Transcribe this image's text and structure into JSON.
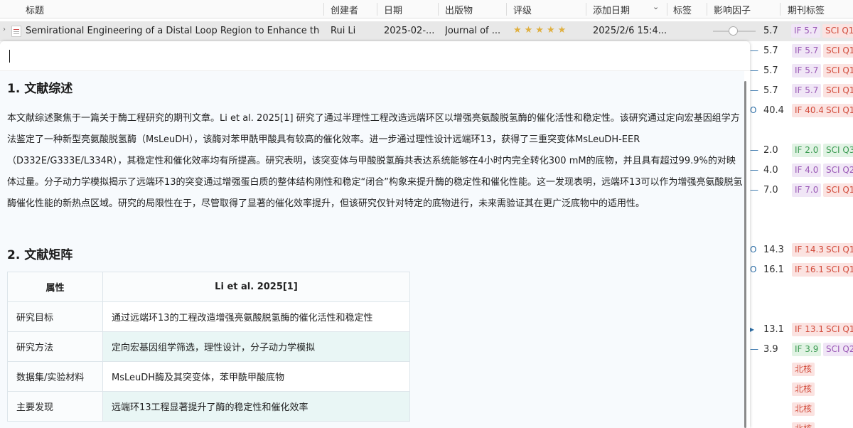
{
  "columns": [
    "标题",
    "创建者",
    "日期",
    "出版物",
    "评级",
    "添加日期",
    "标签",
    "影响因子",
    "期刊标签"
  ],
  "selected_row": {
    "title": "Semirational Engineering of a Distal Loop Region to Enhance the C",
    "creator": "Rui Li",
    "date": "2025-02-...",
    "publication": "Journal of ...",
    "rating_count": 5,
    "rating_glyph": "★★★★★",
    "added": "2025/2/6 15:4...",
    "impact_factor": "5.7",
    "if_tag": "IF 5.7",
    "sci_tag": "SCI Q1"
  },
  "right_rows": [
    {
      "mark": "—",
      "if": "5.7",
      "if_tag": "IF 5.7",
      "sci": "SCI Q1",
      "if_color": "purple",
      "sci_color": "red"
    },
    {
      "mark": "—",
      "if": "5.7",
      "if_tag": "IF 5.7",
      "sci": "SCI Q1",
      "if_color": "purple",
      "sci_color": "red"
    },
    {
      "mark": "—",
      "if": "5.7",
      "if_tag": "IF 5.7",
      "sci": "SCI Q1",
      "if_color": "purple",
      "sci_color": "red"
    },
    {
      "mark": "O",
      "if": "40.4",
      "if_tag": "IF 40.4",
      "sci": "SCI Q1",
      "if_color": "red",
      "sci_color": "red"
    },
    {
      "mark": "—",
      "if": "2.0",
      "if_tag": "IF 2.0",
      "sci": "SCI Q3",
      "if_color": "green",
      "sci_color": "green"
    },
    {
      "mark": "—",
      "if": "4.0",
      "if_tag": "IF 4.0",
      "sci": "SCI Q2",
      "if_color": "purple",
      "sci_color": "purple"
    },
    {
      "mark": "—",
      "if": "7.0",
      "if_tag": "IF 7.0",
      "sci": "SCI Q1",
      "if_color": "purple",
      "sci_color": "red"
    },
    {
      "mark": "O",
      "if": "14.3",
      "if_tag": "IF 14.3",
      "sci": "SCI Q1",
      "if_color": "red",
      "sci_color": "red"
    },
    {
      "mark": "O",
      "if": "16.1",
      "if_tag": "IF 16.1",
      "sci": "SCI Q1",
      "if_color": "red",
      "sci_color": "red"
    },
    {
      "mark": "▸",
      "if": "13.1",
      "if_tag": "IF 13.1",
      "sci": "SCI Q1",
      "if_color": "red",
      "sci_color": "red"
    },
    {
      "mark": "—",
      "if": "3.9",
      "if_tag": "IF 3.9",
      "sci": "SCI Q2",
      "if_color": "green",
      "sci_color": "purple"
    }
  ],
  "beihe_label": "北核",
  "note": {
    "h1": "1. 文献综述",
    "para": "本文献综述聚焦于一篇关于酶工程研究的期刊文章。Li et al. 2025[1] 研究了通过半理性工程改造远端环区以增强亮氨酸脱氢酶的催化活性和稳定性。该研究通过定向宏基因组学方法鉴定了一种新型亮氨酸脱氢酶（MsLeuDH），该酶对苯甲酰甲酸具有较高的催化效率。进一步通过理性设计远端环13，获得了三重突变体MsLeuDH-EER（D332E/G333E/L334R），其稳定性和催化效率均有所提高。研究表明，该突变体与甲酸脱氢酶共表达系统能够在4小时内完全转化300 mM的底物，并且具有超过99.9%的对映体过量。分子动力学模拟揭示了远端环13的突变通过增强蛋白质的整体结构刚性和稳定“闭合”构象来提升酶的稳定性和催化性能。这一发现表明，远端环13可以作为增强亮氨酸脱氢酶催化性能的新热点区域。研究的局限性在于，尽管取得了显著的催化效率提升，但该研究仅针对特定的底物进行，未来需验证其在更广泛底物中的适用性。",
    "h2": "2. 文献矩阵",
    "table": {
      "headers": [
        "属性",
        "Li et al. 2025[1]"
      ],
      "rows": [
        [
          "研究目标",
          "通过远端环13的工程改造增强亮氨酸脱氢酶的催化活性和稳定性"
        ],
        [
          "研究方法",
          "定向宏基因组学筛选，理性设计，分子动力学模拟"
        ],
        [
          "数据集/实验材料",
          "MsLeuDH酶及其突变体，苯甲酰甲酸底物"
        ],
        [
          "主要发现",
          "远端环13工程显著提升了酶的稳定性和催化效率"
        ]
      ]
    }
  },
  "colors": {
    "tag_purple_bg": "#f0e6f6",
    "tag_purple_fg": "#9b59b6",
    "tag_red_bg": "#fbe3e1",
    "tag_red_fg": "#d24c3c",
    "tag_green_bg": "#e1f3e4",
    "tag_green_fg": "#3b9b52",
    "star": "#e0b040"
  }
}
